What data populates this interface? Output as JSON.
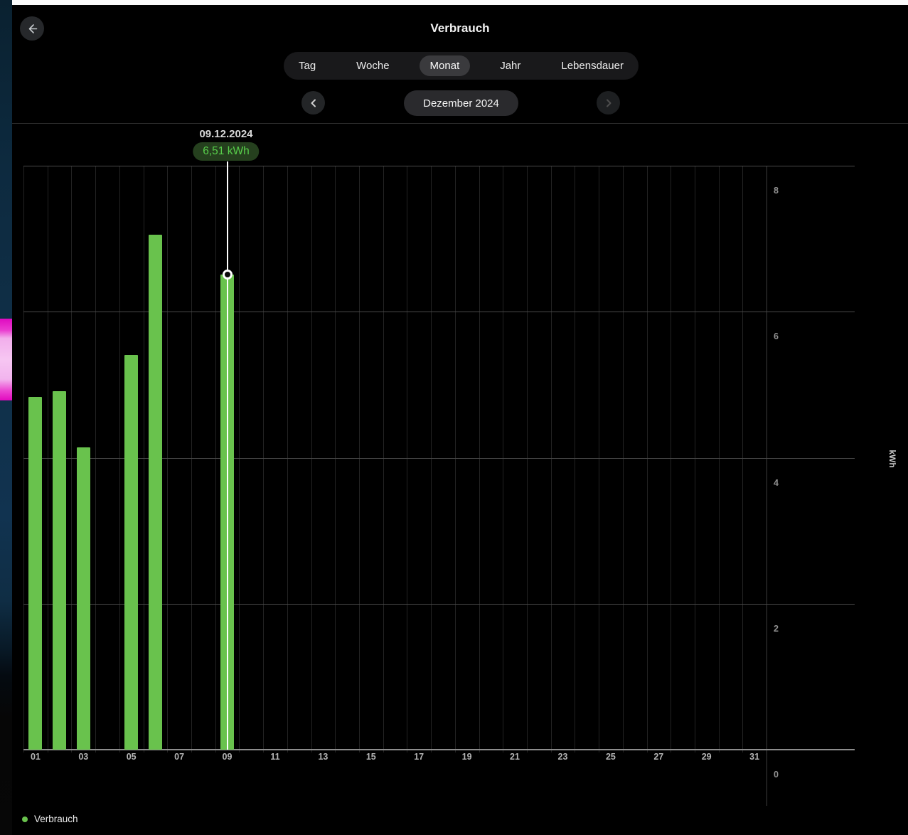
{
  "header": {
    "title": "Verbrauch",
    "back_icon": "arrow-left-icon"
  },
  "tabs": {
    "items": [
      "Tag",
      "Woche",
      "Monat",
      "Jahr",
      "Lebensdauer"
    ],
    "selected": "Monat"
  },
  "date_nav": {
    "label": "Dezember 2024",
    "prev_icon": "chevron-left-icon",
    "next_icon": "chevron-right-icon",
    "next_disabled": true
  },
  "legend": {
    "label": "Verbrauch"
  },
  "colors": {
    "bar": "#69c24d",
    "tooltip_bg": "#25401e",
    "tooltip_text": "#58cf4b",
    "grid_vertical": "#232323",
    "grid_horizontal": "#4a4a4a",
    "axis": "#8d8d8d",
    "background": "#000000"
  },
  "chart_data": {
    "type": "bar",
    "title": "Verbrauch",
    "period": "Dezember 2024",
    "xlabel": "",
    "ylabel": "kWh",
    "ylim": [
      0,
      8
    ],
    "yticks": [
      0,
      2,
      4,
      6,
      8
    ],
    "days_in_month": 31,
    "xtick_labels": [
      "01",
      "03",
      "05",
      "07",
      "09",
      "11",
      "13",
      "15",
      "17",
      "19",
      "21",
      "23",
      "25",
      "27",
      "29",
      "31"
    ],
    "grid": true,
    "legend_position": "bottom-left",
    "series": [
      {
        "name": "Verbrauch",
        "color": "#69c24d",
        "points": [
          {
            "day": 1,
            "value": 4.83
          },
          {
            "day": 2,
            "value": 4.91
          },
          {
            "day": 3,
            "value": 4.14
          },
          {
            "day": 5,
            "value": 5.41
          },
          {
            "day": 6,
            "value": 7.06
          },
          {
            "day": 9,
            "value": 6.51
          }
        ]
      }
    ],
    "highlight": {
      "day": 9,
      "value": 6.51,
      "date_label": "09.12.2024",
      "value_label": "6,51 kWh"
    }
  }
}
